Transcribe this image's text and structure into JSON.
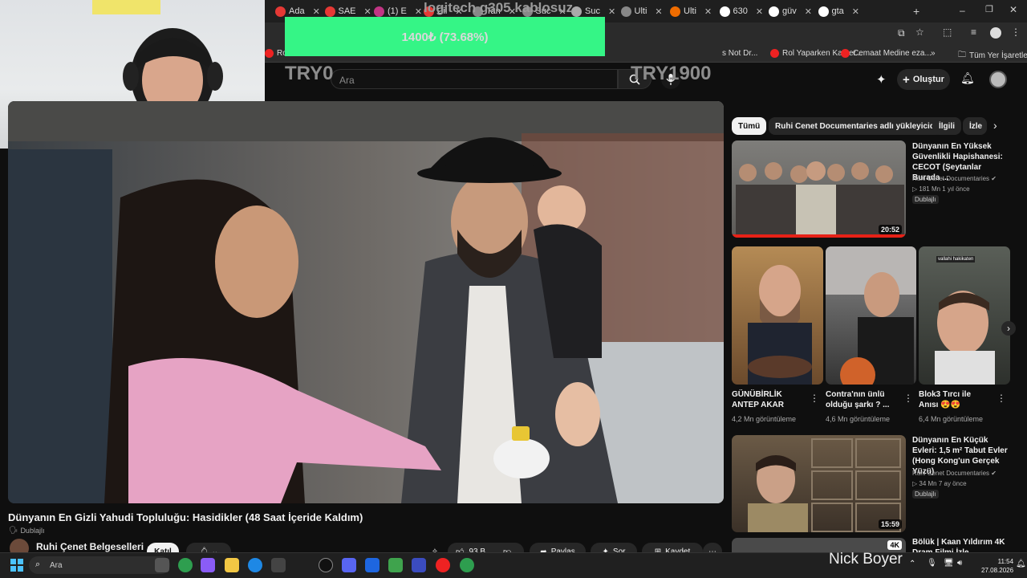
{
  "overlay": {
    "donation_title": "logitech g305 kablosuz",
    "donation_progress": "1400₺ (73.68%)",
    "donation_fraction": 0.7368,
    "try_left": "TRY0",
    "try_right": "TRY1900",
    "streamer_name": "Nick Boyer"
  },
  "browser": {
    "tabs": [
      {
        "label": "Ada",
        "color": "#e53935"
      },
      {
        "label": "SAE",
        "color": "#e53935"
      },
      {
        "label": "(1) E",
        "color": "#c13584"
      },
      {
        "label": "Cil",
        "color": "#e53935"
      },
      {
        "label": "Tan",
        "color": "#888888"
      },
      {
        "label": "Suc",
        "color": "#888888"
      },
      {
        "label": "Suc",
        "color": "#aaaaaa"
      },
      {
        "label": "Ulti",
        "color": "#888888"
      },
      {
        "label": "Ulti",
        "color": "#ef6c00"
      },
      {
        "label": "630",
        "color": "#ffffff"
      },
      {
        "label": "güv",
        "color": "#ffffff"
      },
      {
        "label": "gta",
        "color": "#ffffff"
      }
    ],
    "bookmarks": [
      "Ro",
      "s Not Dr...",
      "Rol Yaparken Kamer...",
      "Cemaat Medine eza...",
      "Tüm Yer İşaretleri"
    ]
  },
  "youtube": {
    "search_placeholder": "Ara",
    "create_label": "Oluştur",
    "video_title": "Dünyanın En Gizli Yahudi Topluluğu: Hasidikler (48 Saat İçeride Kaldım)",
    "dub_label": "Dublajlı",
    "channel_name": "Ruhi Çenet Belgeselleri",
    "join_label": "Katıl",
    "like_count": "93 B",
    "share_label": "Paylaş",
    "ask_label": "Sor",
    "save_label": "Kaydet",
    "chips": [
      "Tümü",
      "Ruhi Cenet Documentaries adlı yükleyiciden",
      "İlgili",
      "İzle"
    ],
    "sidebar": [
      {
        "title": "Dünyanın En Yüksek Güvenlikli Hapishanesi: CECOT (Şeytanlar Burada ...",
        "channel": "Ruhi Cenet Documentaries",
        "meta": "181 Mn  1 yıl önce",
        "duration": "20:52",
        "dub": "Dublajlı"
      },
      {
        "title": "Dünyanın En Küçük Evleri: 1,5 m² Tabut Evler (Hong Kong'un Gerçek Yüzü)",
        "channel": "Ruhi Cenet Documentaries",
        "meta": "34 Mn  7 ay önce",
        "duration": "15:59",
        "dub": "Dublajlı"
      },
      {
        "title": "Bölük | Kaan Yıldırım 4K Dram Filmi İzle",
        "duration": "4K"
      }
    ],
    "shorts": [
      {
        "title": "GÜNÜBİRLİK ANTEP AKAR",
        "views": "4,2 Mn görüntüleme"
      },
      {
        "title": "Contra'nın ünlü olduğu şarkı ? ...",
        "views": "4,6 Mn görüntüleme"
      },
      {
        "title": "Blok3 Tırcı ile Anısı 😍😍",
        "views": "6,4 Mn görüntüleme"
      }
    ],
    "shorts_overlay_text": "vallahi hakikaten"
  },
  "taskbar": {
    "search_placeholder": "Ara",
    "time": "11:54",
    "date": "27.08.2026"
  }
}
